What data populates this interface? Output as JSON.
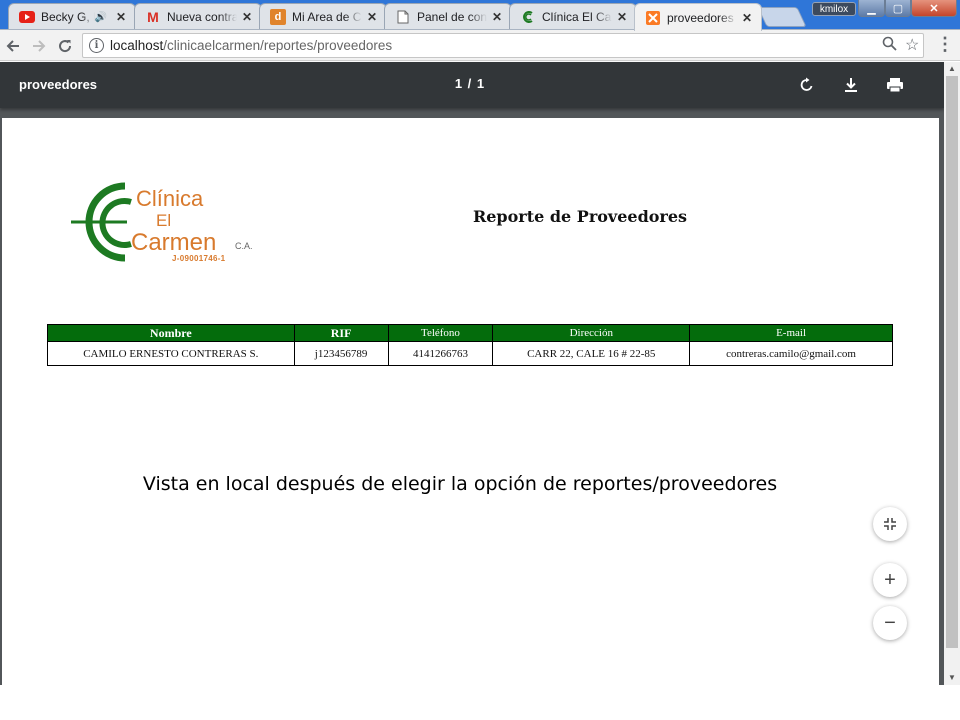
{
  "browser": {
    "tabs": [
      {
        "title": "Becky G, B",
        "favicon": "youtube-icon",
        "audio": true,
        "active": false
      },
      {
        "title": "Nueva contrase",
        "favicon": "gmail-icon",
        "active": false
      },
      {
        "title": "Mi Area de Cl",
        "favicon": "d-app-icon",
        "active": false
      },
      {
        "title": "Panel de cont",
        "favicon": "document-icon",
        "active": false
      },
      {
        "title": "Clínica El Carm",
        "favicon": "clinica-icon",
        "active": false
      },
      {
        "title": "proveedores",
        "favicon": "xampp-icon",
        "active": true
      }
    ],
    "profile_name": "kmilox",
    "url_host": "localhost",
    "url_path": "/clinicaelcarmen/reportes/proveedores"
  },
  "pdf_viewer": {
    "title": "proveedores",
    "page_indicator": "1 / 1"
  },
  "document": {
    "logo": {
      "line1": "Clínica",
      "line2": "El",
      "line3": "Carmen",
      "suffix": "C.A.",
      "rif": "J-09001746-1"
    },
    "title": "Reporte de Proveedores",
    "table": {
      "headers": [
        "Nombre",
        "RIF",
        "Teléfono",
        "Dirección",
        "E-mail"
      ],
      "rows": [
        [
          "CAMILO ERNESTO CONTRERAS S.",
          "j123456789",
          "4141266763",
          "CARR 22, CALE 16 # 22-85",
          "contreras.camilo@gmail.com"
        ]
      ]
    }
  },
  "caption": "Vista en local después de elegir la opción de reportes/proveedores",
  "colors": {
    "table_header": "#046c0c",
    "logo_green": "#1d7a22",
    "logo_orange": "#d87a2d",
    "pdf_toolbar": "#323639"
  }
}
